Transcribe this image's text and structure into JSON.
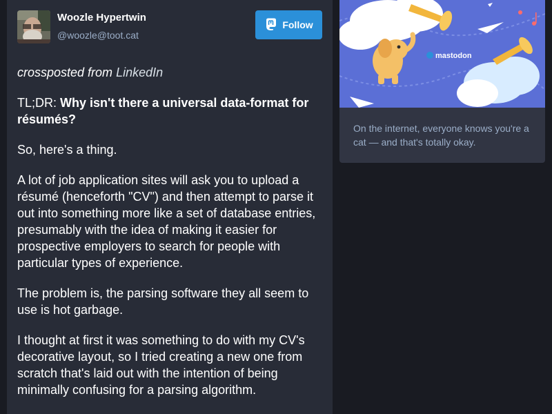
{
  "author": {
    "display_name": "Woozle Hypertwin",
    "handle": "@woozle@toot.cat"
  },
  "follow_button": {
    "label": "Follow",
    "icon": "mastodon-icon"
  },
  "post": {
    "crosspost_prefix": "crossposted from",
    "crosspost_link": "LinkedIn",
    "tldr_prefix": "TL;DR:",
    "tldr_bold": "Why isn't there a universal data-format for résumés?",
    "paragraphs": [
      "So, here's a thing.",
      "A lot of job application sites will ask you to upload a résumé (henceforth \"CV\") and then attempt to parse it out into something more like a set of database entries, presumably with the idea of making it easier for prospective employers to search for people with particular types of experience.",
      "The problem is, the parsing software they all seem to use is hot garbage.",
      "I thought at first it was something to do with my CV's decorative layout, so I tried creating a new one from scratch that's laid out with the intention of being minimally confusing for a parsing algorithm."
    ]
  },
  "sidebar_card": {
    "brand": "mastodon",
    "text": "On the internet, everyone knows you're a cat — and that's totally okay."
  },
  "colors": {
    "background": "#191b22",
    "panel": "#282c37",
    "accent": "#2b90d9",
    "muted_text": "#9baec8"
  }
}
